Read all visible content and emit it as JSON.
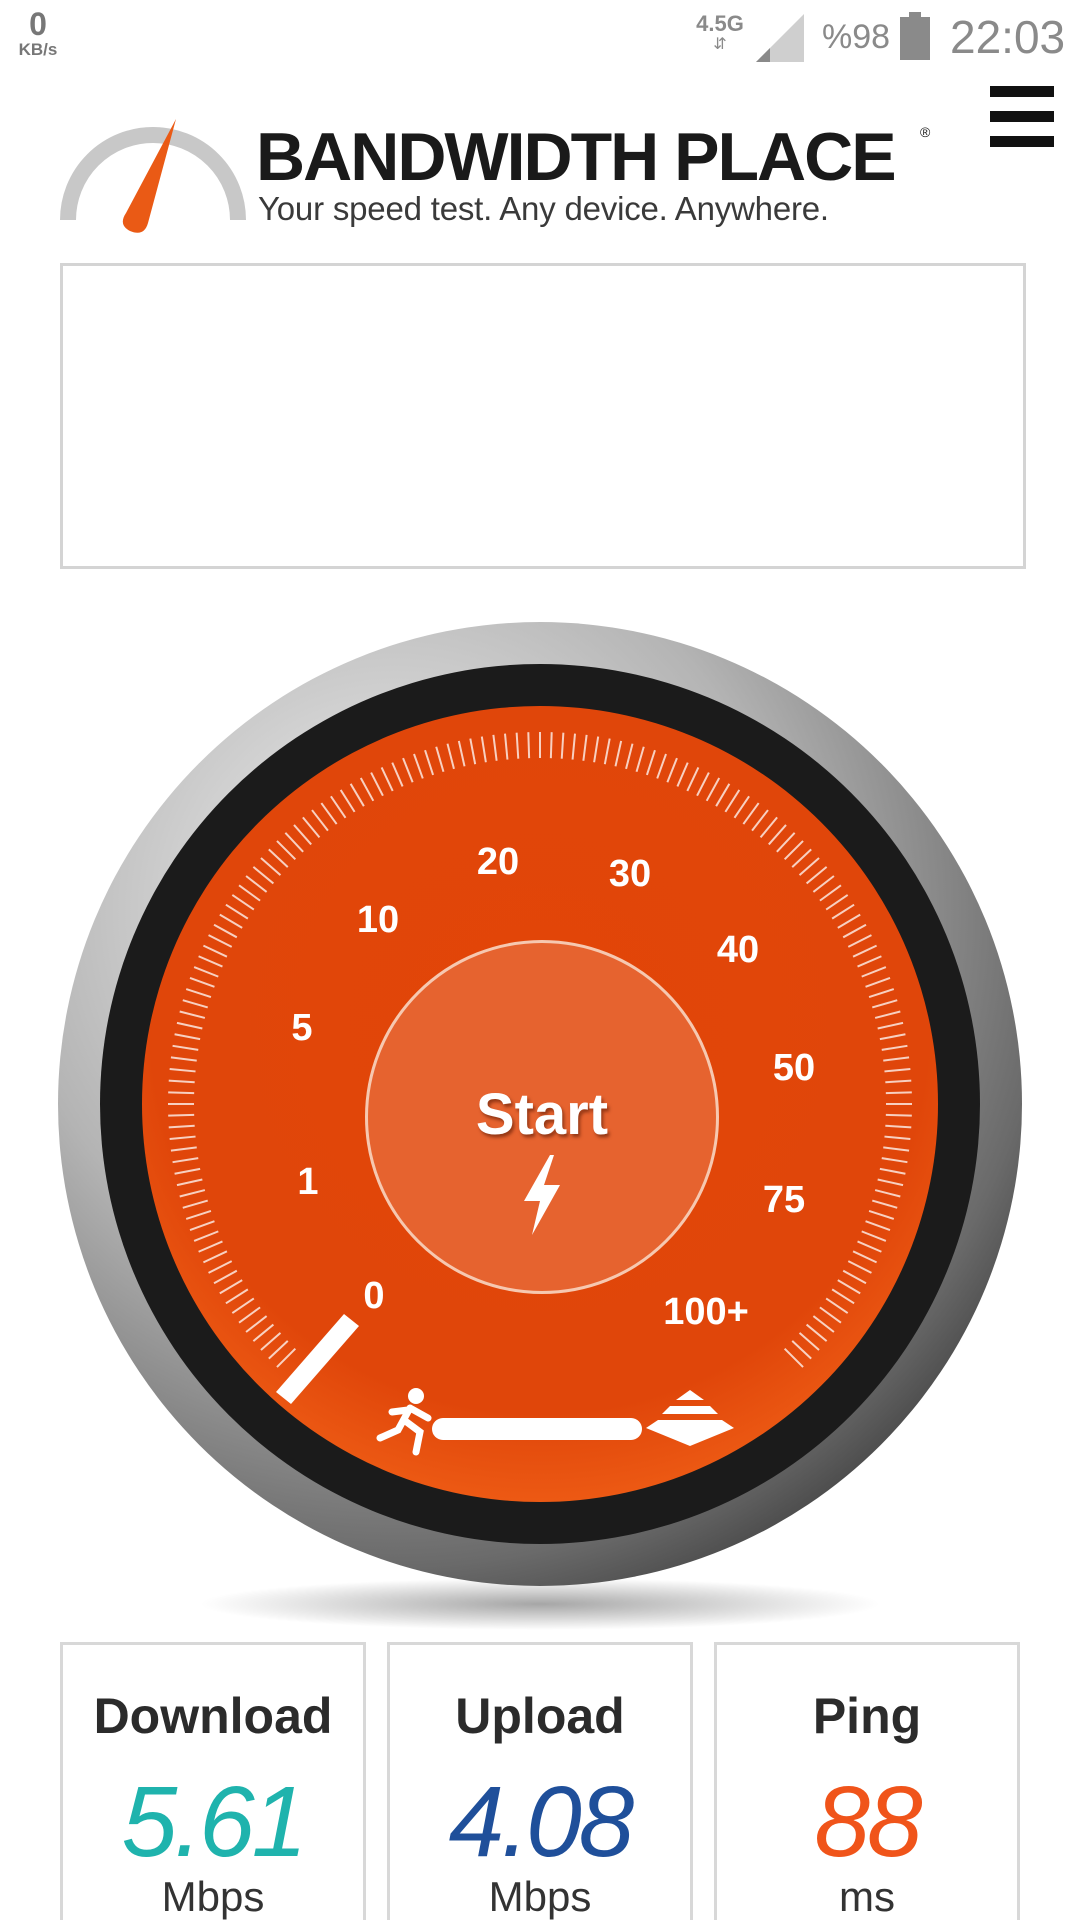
{
  "status_bar": {
    "speed_value": "0",
    "speed_unit": "KB/s",
    "network": "4.5G",
    "network_arrows": "⇵",
    "battery": "%98",
    "time": "22:03"
  },
  "header": {
    "brand": "BANDWIDTH PLACE",
    "brand_mark": "®",
    "tagline": "Your speed test.  Any device.  Anywhere.",
    "menu_icon": "hamburger-icon"
  },
  "gauge": {
    "scale_labels": [
      "0",
      "1",
      "5",
      "10",
      "20",
      "30",
      "40",
      "50",
      "75",
      "100+"
    ],
    "start_label": "Start",
    "left_icon": "running-person-icon",
    "right_icon": "layers-icon",
    "colors": {
      "face": "#e04a0a",
      "face_light": "#f06018",
      "bezel_dark": "#1a1a1a",
      "chrome": "#9a9a9a"
    }
  },
  "results": [
    {
      "title": "Download",
      "value": "5.61",
      "unit": "Mbps",
      "color": "#1fb3ad"
    },
    {
      "title": "Upload",
      "value": "4.08",
      "unit": "Mbps",
      "color": "#1f4f9a"
    },
    {
      "title": "Ping",
      "value": "88",
      "unit": "ms",
      "color": "#f0541a"
    }
  ]
}
